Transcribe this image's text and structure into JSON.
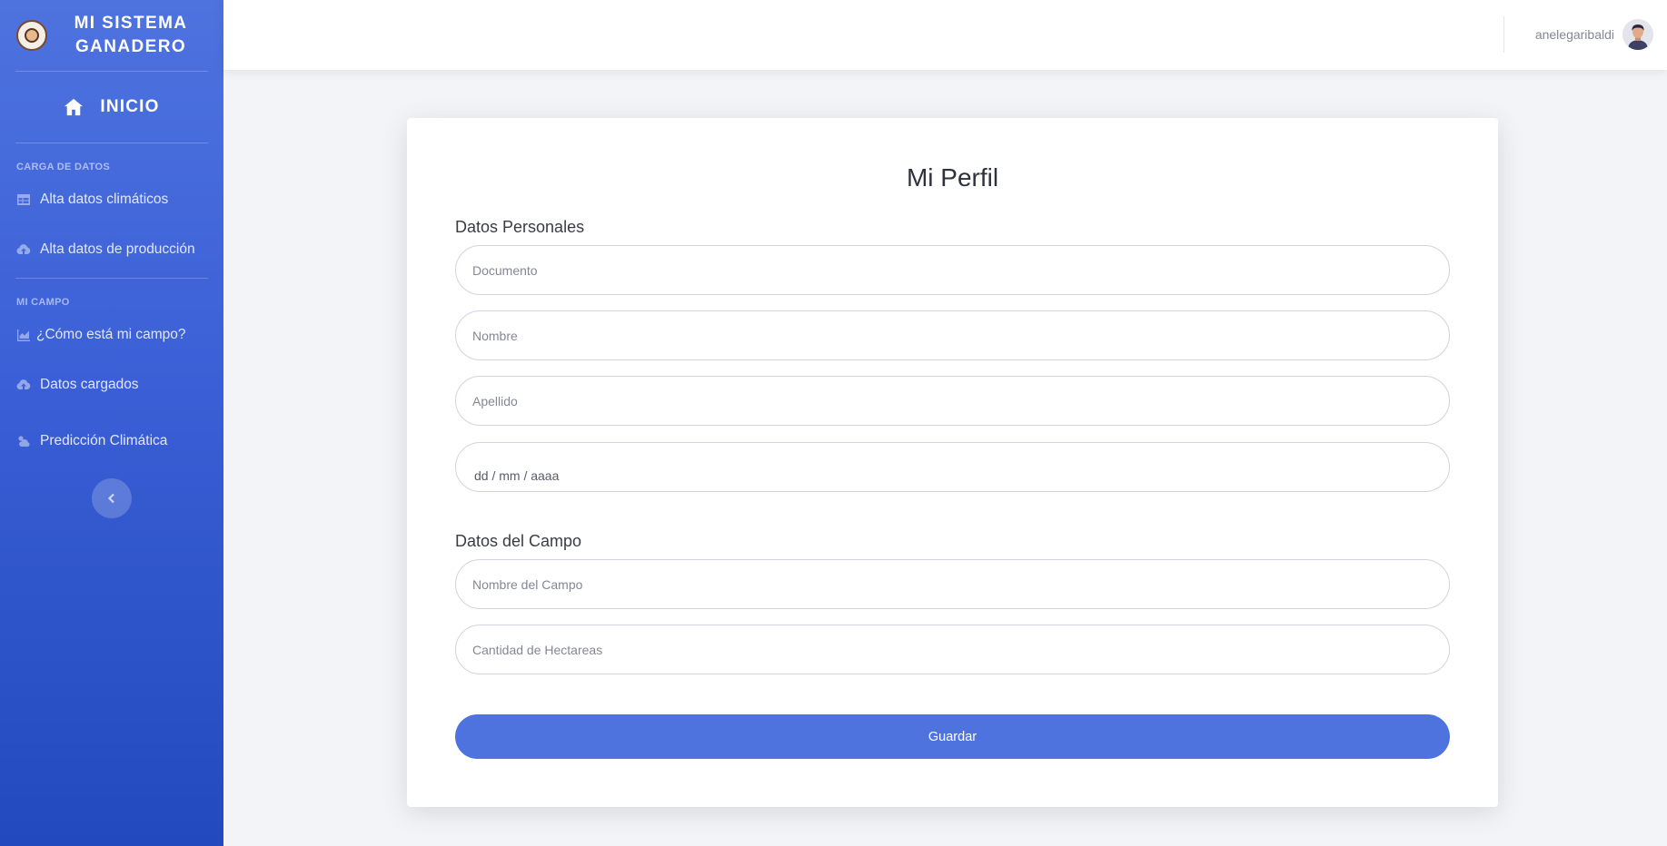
{
  "sidebar": {
    "brand": "MI SISTEMA GANADERO",
    "home": "INICIO",
    "sections": [
      {
        "heading": "CARGA DE DATOS",
        "items": [
          {
            "label": "Alta datos climáticos",
            "icon": "table-icon"
          },
          {
            "label": "Alta datos de producción",
            "icon": "cloud-upload-icon"
          }
        ]
      },
      {
        "heading": "MI CAMPO",
        "items": [
          {
            "label": "¿Cómo está mi campo?",
            "icon": "chart-area-icon"
          },
          {
            "label": "Datos cargados",
            "icon": "cloud-upload-icon"
          },
          {
            "label": "Predicción Climática",
            "icon": "cloud-sun-icon"
          }
        ]
      }
    ],
    "toggle_icon": "chevron-left-icon"
  },
  "topbar": {
    "username": "anelegaribaldi"
  },
  "profile": {
    "title": "Mi Perfil",
    "personal_heading": "Datos Personales",
    "documento_placeholder": "Documento",
    "nombre_placeholder": "Nombre",
    "apellido_placeholder": "Apellido",
    "fecha_placeholder": "dd / mm / aaaa",
    "campo_heading": "Datos del Campo",
    "nombre_campo_placeholder": "Nombre del Campo",
    "hectareas_placeholder": "Cantidad de Hectareas",
    "save_label": "Guardar"
  },
  "colors": {
    "primary": "#4e73df",
    "sidebar_dark": "#224abe",
    "background": "#f3f4f8"
  }
}
